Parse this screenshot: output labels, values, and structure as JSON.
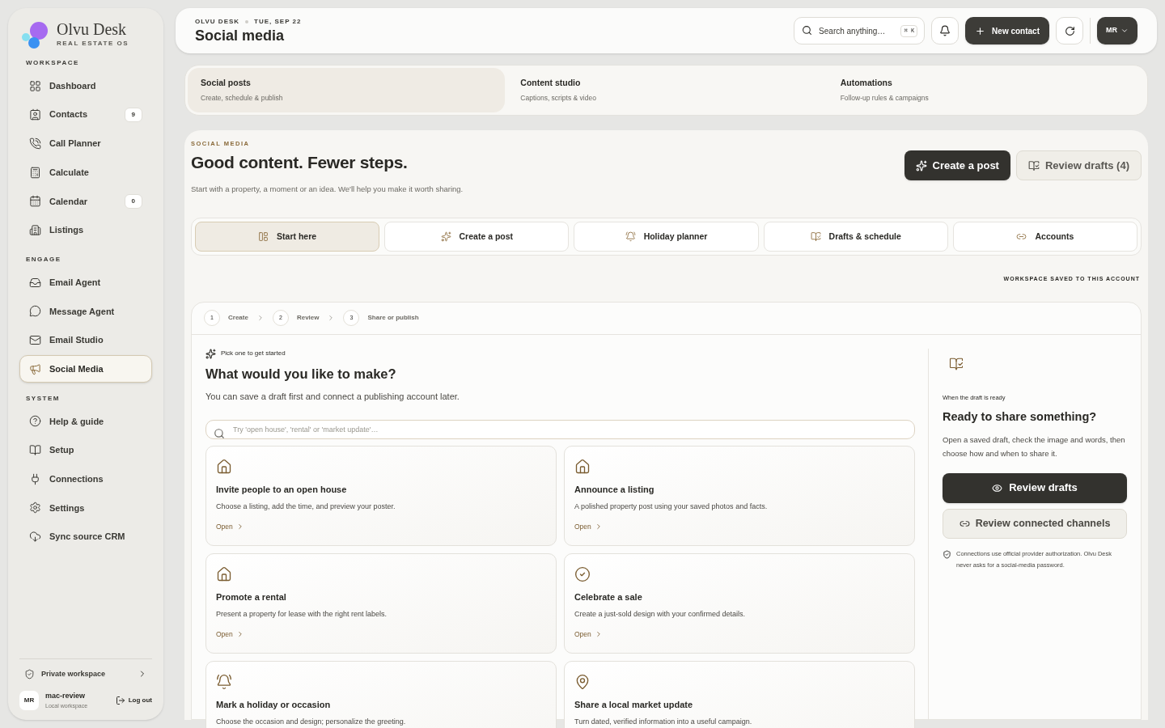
{
  "brand": {
    "name": "Olvu Desk",
    "tagline": "REAL ESTATE OS"
  },
  "sidebar": {
    "sections": [
      {
        "title": "WORKSPACE",
        "items": [
          {
            "label": "Dashboard",
            "selected": false
          },
          {
            "label": "Contacts",
            "badge": "9",
            "selected": false
          },
          {
            "label": "Call Planner",
            "selected": false
          },
          {
            "label": "Calculate",
            "selected": false
          },
          {
            "label": "Calendar",
            "badge": "0",
            "selected": false
          },
          {
            "label": "Listings",
            "selected": false
          }
        ]
      },
      {
        "title": "ENGAGE",
        "items": [
          {
            "label": "Email Agent",
            "selected": false
          },
          {
            "label": "Message Agent",
            "selected": false
          },
          {
            "label": "Email Studio",
            "selected": false
          },
          {
            "label": "Social Media",
            "selected": true
          }
        ]
      },
      {
        "title": "SYSTEM",
        "items": [
          {
            "label": "Help & guide",
            "selected": false
          },
          {
            "label": "Setup",
            "selected": false
          },
          {
            "label": "Connections",
            "selected": false
          },
          {
            "label": "Settings",
            "selected": false
          },
          {
            "label": "Sync source CRM",
            "selected": false
          }
        ]
      }
    ],
    "privacy": "Private workspace",
    "user": {
      "initials": "MR",
      "name": "mac-review",
      "subtitle": "Local workspace"
    },
    "logout": "Log out"
  },
  "header": {
    "breadcrumb": [
      "OLVU DESK",
      "TUE, SEP 22"
    ],
    "title": "Social media",
    "search": {
      "placeholder": "Search anything…",
      "shortcut": "⌘ K"
    },
    "new_contact": "New contact",
    "account": "MR"
  },
  "section_tabs": [
    {
      "title": "Social posts",
      "subtitle": "Create, schedule & publish",
      "selected": true
    },
    {
      "title": "Content studio",
      "subtitle": "Captions, scripts & video",
      "selected": false
    },
    {
      "title": "Automations",
      "subtitle": "Follow-up rules & campaigns",
      "selected": false
    }
  ],
  "hero": {
    "overline": "SOCIAL MEDIA",
    "title": "Good content. Fewer steps.",
    "subtitle": "Start with a property, a moment or an idea. We'll help you make it worth sharing.",
    "primary": "Create a post",
    "secondary": "Review drafts (4)"
  },
  "tabs": [
    {
      "label": "Start here",
      "selected": true
    },
    {
      "label": "Create a post",
      "selected": false
    },
    {
      "label": "Holiday planner",
      "selected": false
    },
    {
      "label": "Drafts & schedule",
      "selected": false
    },
    {
      "label": "Accounts",
      "selected": false
    }
  ],
  "saved_note": "WORKSPACE SAVED TO THIS ACCOUNT",
  "steps": [
    {
      "number": "1",
      "label": "Create"
    },
    {
      "number": "2",
      "label": "Review"
    },
    {
      "number": "3",
      "label": "Share or publish"
    }
  ],
  "picker": {
    "eyebrow": "Pick one to get started",
    "title": "What would you like to make?",
    "subtitle": "You can save a draft first and connect a publishing account later.",
    "search": {
      "placeholder": "Try 'open house', 'rental' or 'market update'…"
    },
    "cards": [
      {
        "kind": "house",
        "title": "Invite people to an open house",
        "description": "Choose a listing, add the time, and preview your poster.",
        "link": "Open"
      },
      {
        "kind": "house",
        "title": "Announce a listing",
        "description": "A polished property post using your saved photos and facts.",
        "link": "Open"
      },
      {
        "kind": "house",
        "title": "Promote a rental",
        "description": "Present a property for lease with the right rent labels.",
        "link": "Open"
      },
      {
        "kind": "check",
        "title": "Celebrate a sale",
        "description": "Create a just-sold design with your confirmed details.",
        "link": "Open"
      },
      {
        "kind": "bell",
        "title": "Mark a holiday or occasion",
        "description": "Choose the occasion and design; personalize the greeting."
      },
      {
        "kind": "pin",
        "title": "Share a local market update",
        "description": "Turn dated, verified information into a useful campaign."
      }
    ]
  },
  "ready": {
    "eyebrow": "When the draft is ready",
    "title": "Ready to share something?",
    "body": "Open a saved draft, check the image and words, then choose how and when to share it.",
    "primary": "Review drafts",
    "secondary": "Review connected channels",
    "note": "Connections use official provider authorization. Olvu Desk never asks for a social-media password."
  }
}
